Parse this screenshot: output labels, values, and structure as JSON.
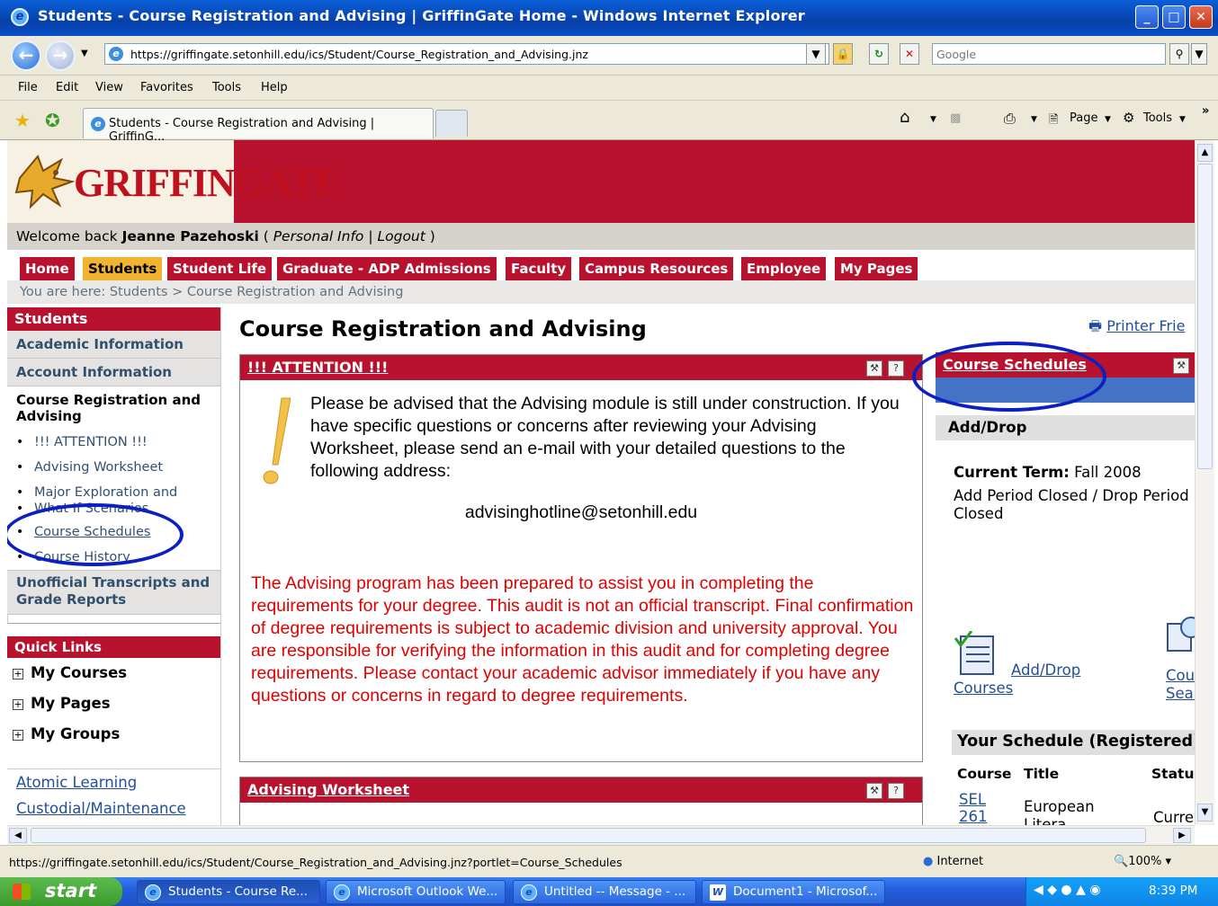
{
  "window": {
    "title": "Students - Course Registration and Advising | GriffinGate Home - Windows Internet Explorer",
    "min": "_",
    "max": "□",
    "close": "✕"
  },
  "address": {
    "url": "https://griffingate.setonhill.edu/ics/Student/Course_Registration_and_Advising.jnz",
    "search_placeholder": "Google"
  },
  "menu": [
    "File",
    "Edit",
    "View",
    "Favorites",
    "Tools",
    "Help"
  ],
  "tabbar": {
    "tab_title": "Students - Course Registration and Advising | GriffinG...",
    "page_label": "Page",
    "tools_label": "Tools"
  },
  "site": {
    "logo_text": "GRIFFINGATE",
    "welcome": {
      "prefix": "Welcome back ",
      "user": "Jeanne Pazehoski",
      "open": " ( ",
      "personal_info": "Personal Info",
      "sep": " | ",
      "logout": "Logout",
      "close": " )"
    },
    "nav_tabs": [
      "Home",
      "Students",
      "Student Life",
      "Graduate - ADP Admissions",
      "Faculty",
      "Campus Resources",
      "Employee",
      "My Pages"
    ],
    "active_tab": "Students",
    "breadcrumb": "You are here:  Students > Course Registration and Advising"
  },
  "sidebar": {
    "heading": "Students",
    "items": [
      {
        "label": "Academic Information"
      },
      {
        "label": "Account Information"
      },
      {
        "label": "Course Registration and Advising"
      }
    ],
    "sub_items": [
      "!!! ATTENTION !!!",
      "Advising Worksheet",
      "Major Exploration and",
      "What If Scenarios",
      "Course Schedules",
      "Course History"
    ],
    "bottom_item": "Unofficial Transcripts and Grade Reports",
    "quick_links_heading": "Quick Links",
    "quick_links": [
      "My Courses",
      "My Pages",
      "My Groups"
    ],
    "external_links": [
      "Atomic Learning",
      "Custodial/Maintenance"
    ]
  },
  "main": {
    "title": "Course Registration and Advising",
    "printer_link": "Printer Frie",
    "attention": {
      "heading": "!!! ATTENTION !!!",
      "message": "Please be advised that the Advising module is still under construction.  If you have specific questions or concerns after reviewing your Advising Worksheet, please send an e-mail with your detailed questions to the following address:",
      "email": "advisinghotline@setonhill.edu",
      "disclaimer": "The Advising program has been prepared to assist you in completing the requirements for your degree.  This audit is not an official transcript.  Final confirmation of degree requirements is subject to academic division and university approval.  You are responsible for verifying the information in this audit and for completing degree requirements.  Please contact your academic advisor immediately if you have any questions or concerns in regard to degree requirements."
    },
    "worksheet_heading": "Advising Worksheet"
  },
  "course_schedules": {
    "heading": "Course Schedules",
    "add_drop_heading": "Add/Drop",
    "current_term_label": "Current Term:",
    "current_term_value": "Fall 2008",
    "period_status": "Add Period Closed / Drop Period Closed",
    "add_drop_link_1": "Add/Drop",
    "add_drop_link_2": "Courses",
    "course_search_link_1": "Cour",
    "course_search_link_2": "Sear",
    "schedule_heading": "Your Schedule (Registered)",
    "columns": [
      "Course",
      "Title",
      "Status"
    ],
    "rows": [
      {
        "course": "SEL 261",
        "title": "European Litera",
        "status": "Curre"
      }
    ]
  },
  "statusbar": {
    "url": "https://griffingate.setonhill.edu/ics/Student/Course_Registration_and_Advising.jnz?portlet=Course_Schedules",
    "zone": "Internet",
    "zoom": "100%"
  },
  "taskbar": {
    "start": "start",
    "tasks": [
      "Students - Course Re...",
      "Microsoft Outlook We...",
      "Untitled -- Message - ...",
      "Document1 - Microsof..."
    ],
    "clock": "8:39 PM"
  },
  "colors": {
    "brand_red": "#b8122e",
    "active_tab": "#f2b330",
    "link": "#1f4f99",
    "annotation": "#0c1fc1",
    "disclaimer": "#e00000"
  }
}
